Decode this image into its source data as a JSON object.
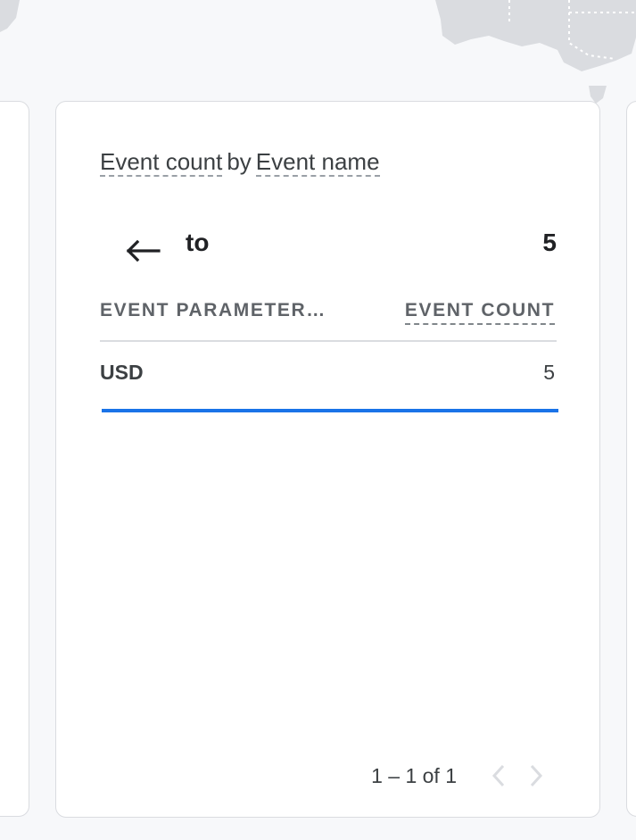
{
  "card": {
    "title_metric": "Event count",
    "title_by": "by",
    "title_dimension": "Event name",
    "drill": {
      "label": "to",
      "value": "5"
    },
    "table": {
      "columns": [
        "EVENT PARAMETER…",
        "EVENT COUNT"
      ],
      "rows": [
        {
          "label": "USD",
          "value": "5",
          "bar_fraction": 1.0
        }
      ]
    },
    "pagination": {
      "text": "1 – 1 of 1"
    }
  },
  "colors": {
    "bar": "#1a73e8",
    "map_land": "#dadce0",
    "background": "#f7f8fa"
  },
  "icons": {
    "back": "arrow-left-icon",
    "prev": "chevron-left-icon",
    "next": "chevron-right-icon"
  }
}
